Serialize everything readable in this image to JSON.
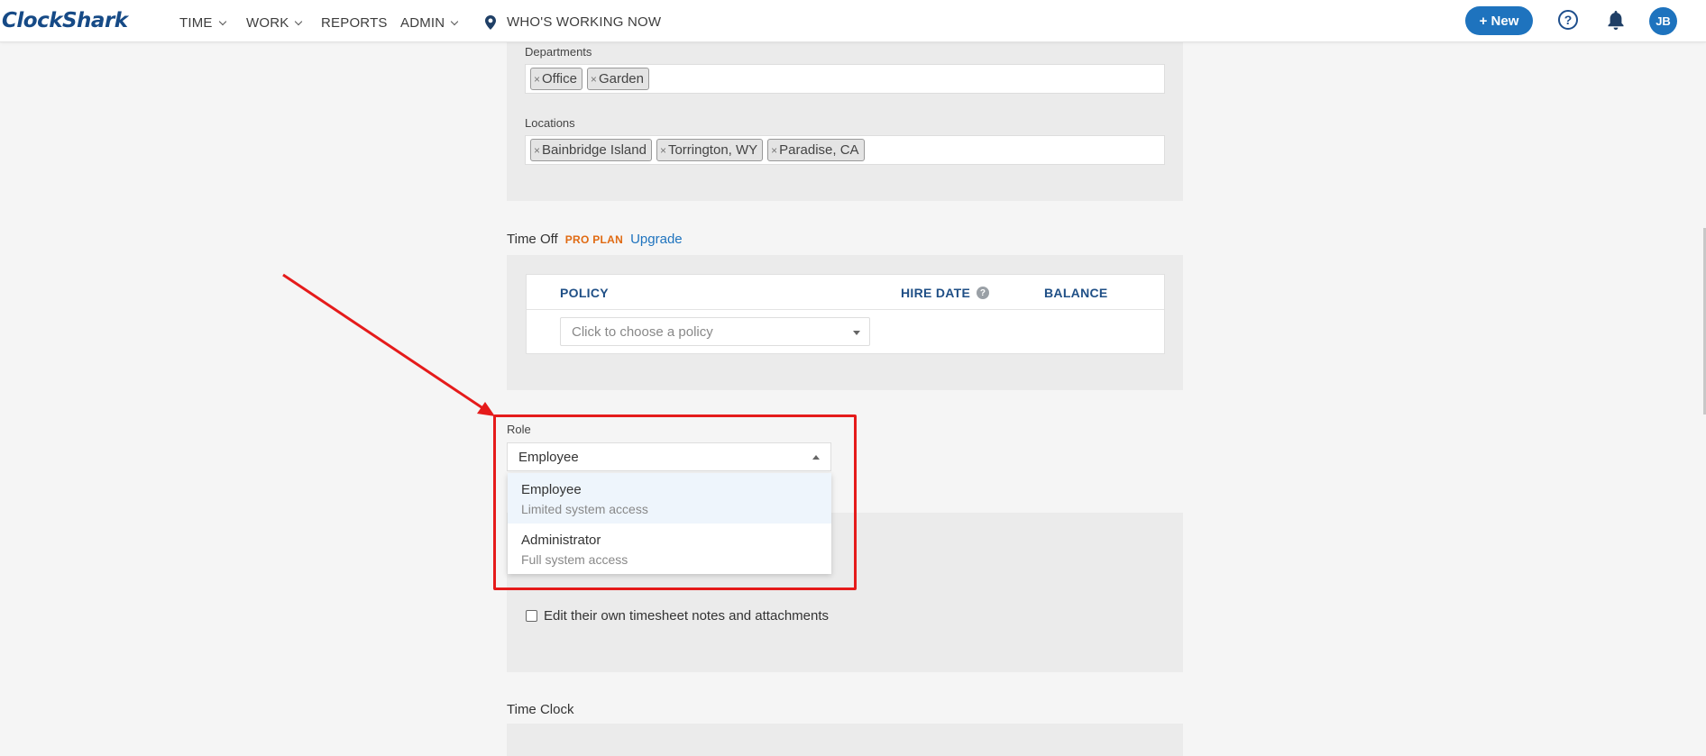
{
  "app": {
    "logo": "ClockShark"
  },
  "nav": {
    "items": [
      {
        "label": "TIME",
        "has_caret": true
      },
      {
        "label": "WORK",
        "has_caret": true
      },
      {
        "label": "REPORTS",
        "has_caret": false
      },
      {
        "label": "ADMIN",
        "has_caret": true
      }
    ],
    "whos_working": "WHO'S WORKING NOW",
    "new_button": "+ New",
    "help_icon_glyph": "?",
    "avatar_initials": "JB"
  },
  "departments": {
    "label": "Departments",
    "tags": [
      "Office",
      "Garden"
    ]
  },
  "locations": {
    "label": "Locations",
    "tags": [
      "Bainbridge Island",
      "Torrington, WY",
      "Paradise, CA"
    ]
  },
  "time_off": {
    "title": "Time Off",
    "plan_badge": "PRO PLAN",
    "upgrade_link": "Upgrade",
    "columns": {
      "policy": "POLICY",
      "hire_date": "HIRE DATE",
      "balance": "BALANCE"
    },
    "policy_placeholder": "Click to choose a policy"
  },
  "role": {
    "label": "Role",
    "selected": "Employee",
    "options": [
      {
        "title": "Employee",
        "subtitle": "Limited system access"
      },
      {
        "title": "Administrator",
        "subtitle": "Full system access"
      }
    ]
  },
  "permissions": {
    "edit_notes": "Edit their own timesheet notes and attachments"
  },
  "time_clock": {
    "title": "Time Clock"
  },
  "colors": {
    "brand": "#164a86",
    "accent": "#1e73be",
    "annotation": "#e51b1b",
    "pro_badge": "#e06a12"
  }
}
